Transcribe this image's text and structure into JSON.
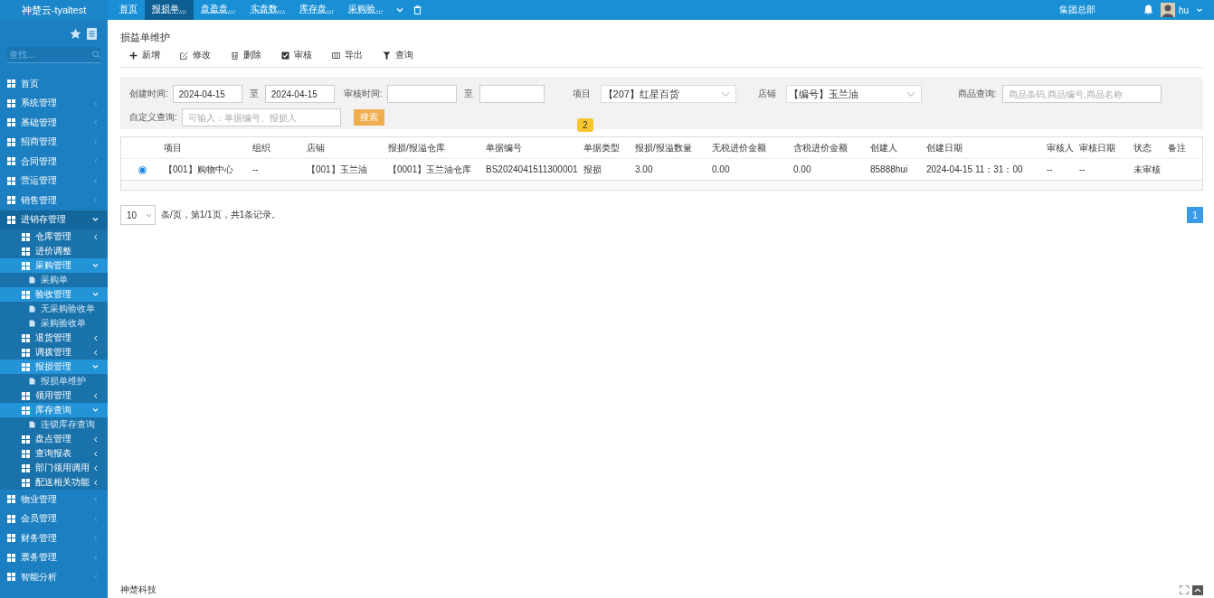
{
  "app_title": "神楚云-tyaltest",
  "top_tabs": [
    {
      "label": "首页",
      "selected": false
    },
    {
      "label": "报损单...",
      "selected": true
    },
    {
      "label": "盘盈盘...",
      "selected": false
    },
    {
      "label": "实盘数...",
      "selected": false
    },
    {
      "label": "库存盘...",
      "selected": false
    },
    {
      "label": "采购验...",
      "selected": false
    }
  ],
  "org_name": "集团总部",
  "user_name": "hu",
  "sidebar": {
    "search_placeholder": "查找...",
    "items": [
      {
        "label": "首页"
      },
      {
        "label": "系统管理",
        "expanded": false
      },
      {
        "label": "基础管理",
        "expanded": false
      },
      {
        "label": "招商管理",
        "expanded": false
      },
      {
        "label": "合同管理",
        "expanded": false
      },
      {
        "label": "营运管理",
        "expanded": false
      },
      {
        "label": "销售管理",
        "expanded": false
      },
      {
        "label": "进销存管理",
        "expanded": true,
        "children": [
          {
            "label": "仓库管理",
            "expanded": false
          },
          {
            "label": "进价调整"
          },
          {
            "label": "采购管理",
            "expanded": true,
            "children": [
              {
                "label": "采购单"
              }
            ]
          },
          {
            "label": "验收管理",
            "expanded": true,
            "children": [
              {
                "label": "无采购验收单"
              },
              {
                "label": "采购验收单"
              }
            ]
          },
          {
            "label": "退货管理",
            "expanded": false
          },
          {
            "label": "调拨管理",
            "expanded": false
          },
          {
            "label": "报损管理",
            "expanded": true,
            "children": [
              {
                "label": "报损单维护"
              }
            ]
          },
          {
            "label": "领用管理",
            "expanded": false
          },
          {
            "label": "库存查询",
            "expanded": true,
            "children": [
              {
                "label": "连锁库存查询"
              }
            ]
          },
          {
            "label": "盘点管理",
            "expanded": false
          },
          {
            "label": "查询报表",
            "expanded": false
          },
          {
            "label": "部门领用调用",
            "expanded": false
          },
          {
            "label": "配送相关功能",
            "expanded": false
          }
        ]
      },
      {
        "label": "物业管理",
        "expanded": false
      },
      {
        "label": "会员管理",
        "expanded": false
      },
      {
        "label": "财务管理",
        "expanded": false
      },
      {
        "label": "票务管理",
        "expanded": false
      },
      {
        "label": "智能分析",
        "expanded": false
      }
    ]
  },
  "page_title": "损益单维护",
  "toolbar": [
    "新增",
    "修改",
    "删除",
    "审核",
    "导出",
    "查询"
  ],
  "filters": {
    "created_label": "创建时间:",
    "created_from": "2024-04-15",
    "to_1": "至",
    "created_to": "2024-04-15",
    "audit_label": "审核时间:",
    "to_2": "至",
    "project_label": "项目",
    "project_value": "【207】红星百货",
    "store_label": "店铺",
    "store_value": "【编号】玉兰油",
    "goods_label": "商品查询:",
    "goods_placeholder": "商品条码,商品编号,商品名称",
    "custom_label": "自定义查询:",
    "custom_placeholder": "可输入：单据编号、报损人",
    "search_button": "搜索"
  },
  "badge": "2",
  "table": {
    "columns": [
      "项目",
      "组织",
      "店铺",
      "报损/报溢仓库",
      "单据编号",
      "单据类型",
      "报损/报溢数量",
      "无税进价金额",
      "含税进价金额",
      "创建人",
      "创建日期",
      "审核人",
      "审核日期",
      "状态",
      "备注"
    ],
    "rows": [
      {
        "selected": true,
        "cells": [
          "【001】购物中心",
          "--",
          "【001】玉兰油",
          "【0001】玉兰油仓库",
          "BS2024041511300001",
          "报损",
          "3.00",
          "0.00",
          "0.00",
          "85888hui",
          "2024-04-15 11：31：00",
          "--",
          "--",
          "未审核",
          ""
        ]
      }
    ]
  },
  "pagination": {
    "page_size": "10",
    "summary": "条/页，第1/1页，共1条记录。",
    "pages": [
      {
        "label": "1",
        "selected": true
      }
    ]
  },
  "footer": "神楚科技"
}
